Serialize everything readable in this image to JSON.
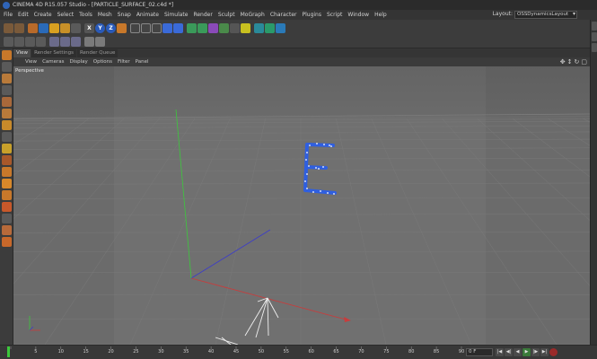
{
  "window": {
    "title": "CINEMA 4D R15.057 Studio - [PARTICLE_SURFACE_02.c4d *]"
  },
  "menubar": {
    "items": [
      "File",
      "Edit",
      "Create",
      "Select",
      "Tools",
      "Mesh",
      "Snap",
      "Animate",
      "Simulate",
      "Render",
      "Sculpt",
      "MoGraph",
      "Character",
      "Plugins",
      "Script",
      "Window",
      "Help"
    ],
    "layout_label": "Layout:",
    "layout_value": "OSSDynamicsLayout"
  },
  "toolbar_icons": {
    "row1": [
      "undo-icon",
      "redo-icon",
      "live-selection-icon",
      "move-icon",
      "scale-icon",
      "rotate-icon",
      "recent-tools-icon",
      "x-axis-icon",
      "y-axis-icon",
      "z-axis-icon",
      "coordinate-system-icon",
      "render-view-icon",
      "render-picture-viewer-icon",
      "render-settings-icon",
      "cube-icon",
      "pen-icon",
      "subdivision-icon",
      "array-icon",
      "deformer-icon",
      "floor-icon",
      "camera-icon",
      "light-icon",
      "mograph-icon",
      "cloner-icon",
      "effector-icon"
    ],
    "row2": [
      "make-editable-icon",
      "model-mode-icon",
      "texture-mode-icon",
      "workplane-icon",
      "axis-mode-icon",
      "points-mode-icon",
      "edges-mode-icon",
      "polygons-mode-icon",
      "snap-icon"
    ],
    "axis_labels": {
      "x": "X",
      "y": "Y",
      "z": "Z"
    }
  },
  "viewport": {
    "tabs": [
      {
        "label": "View",
        "active": true
      },
      {
        "label": "Render Settings",
        "active": false
      },
      {
        "label": "Render Queue",
        "active": false
      }
    ],
    "menu": [
      "View",
      "Cameras",
      "Display",
      "Options",
      "Filter",
      "Panel"
    ],
    "camera_label": "Perspective",
    "colors": {
      "x_axis": "#c83c3c",
      "y_axis": "#3cc83c",
      "z_axis": "#3c3cc8",
      "particles": "#2f5fe0"
    }
  },
  "timeline": {
    "ticks": [
      0,
      5,
      10,
      15,
      20,
      25,
      30,
      35,
      40,
      45,
      50,
      55,
      60,
      65,
      70,
      75,
      80,
      85,
      90
    ],
    "current_frame": "0 F",
    "transport": [
      "go-start-icon",
      "step-back-icon",
      "play-back-icon",
      "play-icon",
      "step-forward-icon",
      "go-end-icon",
      "record-icon"
    ]
  }
}
